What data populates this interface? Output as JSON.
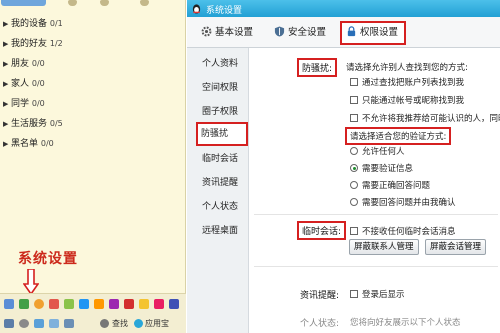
{
  "contact_panel": {
    "groups": [
      {
        "name": "我的设备",
        "count": "0/1",
        "expanded": false
      },
      {
        "name": "我的好友",
        "count": "1/2",
        "expanded": false
      },
      {
        "name": "朋友",
        "count": "0/0",
        "expanded": false
      },
      {
        "name": "家人",
        "count": "0/0",
        "expanded": false
      },
      {
        "name": "同学",
        "count": "0/0",
        "expanded": false
      },
      {
        "name": "生活服务",
        "count": "0/5",
        "expanded": false
      },
      {
        "name": "黑名单",
        "count": "0/0",
        "expanded": false
      }
    ],
    "annotation": "系统设置",
    "annotation_color": "#cc2a1c",
    "bottom_search": "查找",
    "bottom_app_center": "应用宝"
  },
  "window": {
    "title": "系统设置",
    "title_bar_color": "#22a0d4",
    "tabs": [
      {
        "label": "基本设置",
        "icon": "gear-icon",
        "active": false
      },
      {
        "label": "安全设置",
        "icon": "shield-icon",
        "active": false
      },
      {
        "label": "权限设置",
        "icon": "lock-icon",
        "active": true
      }
    ],
    "sidebar": [
      {
        "label": "个人资料",
        "active": false
      },
      {
        "label": "空间权限",
        "active": false
      },
      {
        "label": "圈子权限",
        "active": false
      },
      {
        "label": "防骚扰",
        "active": true
      },
      {
        "label": "临时会话",
        "active": false
      },
      {
        "label": "资讯提醒",
        "active": false
      },
      {
        "label": "个人状态",
        "active": false
      },
      {
        "label": "远程桌面",
        "active": false
      }
    ],
    "highlight_color": "#d52020",
    "anti_harassment": {
      "label": "防骚扰:",
      "find_prompt": "请选择允许别人查找到您的方式:",
      "find_options": [
        {
          "label": "通过查找把账户列表找到我",
          "checked": false
        },
        {
          "label": "只能通过帐号或昵称找到我",
          "checked": false
        },
        {
          "label": "不允许将我推荐给可能认识的人，同时",
          "checked": false
        }
      ],
      "verify_prompt": "请选择适合您的验证方式:",
      "verify_options": [
        {
          "label": "允许任何人",
          "selected": false
        },
        {
          "label": "需要验证信息",
          "selected": true
        },
        {
          "label": "需要正确回答问题",
          "selected": false
        },
        {
          "label": "需要回答问题并由我确认",
          "selected": false
        }
      ]
    },
    "temp_session": {
      "label": "临时会话:",
      "option": "不接收任何临时会话消息",
      "checked": false,
      "button_blocked": "屏蔽联系人管理",
      "button_session": "屏蔽会话管理"
    },
    "info_reminder": {
      "label": "资讯提醒:",
      "option": "登录后显示"
    },
    "personal_status": {
      "label": "个人状态:",
      "text": "您将向好友展示以下个人状态"
    }
  }
}
